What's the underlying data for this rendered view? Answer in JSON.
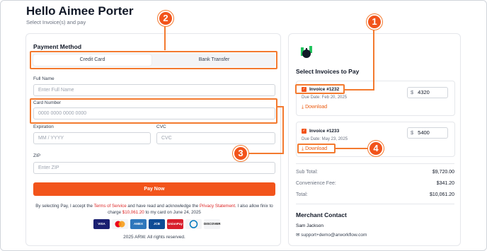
{
  "header": {
    "title": "Hello Aimee Porter",
    "subtitle": "Select Invoice(s) and pay"
  },
  "payment": {
    "section_title": "Payment Method",
    "tabs": [
      {
        "label": "Credit Card",
        "active": true
      },
      {
        "label": "Bank Transfer",
        "active": false
      }
    ],
    "full_name": {
      "label": "Full Name",
      "placeholder": "Enter Full Name"
    },
    "card_number": {
      "label": "Card Number",
      "placeholder": "0000 0000 0000 0000"
    },
    "expiration": {
      "label": "Expiration",
      "placeholder": "MM / YYYY"
    },
    "cvc": {
      "label": "CVC",
      "placeholder": "CVC"
    },
    "zip": {
      "label": "ZIP",
      "placeholder": "Enter ZIP"
    },
    "pay_button": "Pay Now",
    "terms": {
      "prefix": "By selecting Pay, I accept the ",
      "tos": "Terms of Service",
      "middle": " and have read and acknowledge the ",
      "privacy": "Privacy Statement",
      "suffix": ". I also allow finix to charge ",
      "amount": "$10,061.20",
      "end": " to my card on June 24, 2025"
    },
    "card_brands": [
      "VISA",
      "mastercard",
      "AMEX",
      "JCB",
      "UnionPay",
      "Diners",
      "DISCOVER"
    ],
    "copyright": "2025 ARW. All rights reserved."
  },
  "invoices": {
    "section_title": "Select Invoices to Pay",
    "items": [
      {
        "name": "Invoice #1232",
        "due": "Due Date: Feb 20, 2025",
        "download": "Download",
        "currency": "$",
        "amount": "4320"
      },
      {
        "name": "Invoice #1233",
        "due": "Due Date: May 23, 2025",
        "download": "Download",
        "currency": "$",
        "amount": "5400"
      }
    ]
  },
  "summary": {
    "subtotal_label": "Sub Total:",
    "subtotal": "$9,720.00",
    "fee_label": "Convenience Fee:",
    "fee": "$341.20",
    "total_label": "Total:",
    "total": "$10,061.20"
  },
  "merchant": {
    "title": "Merchant Contact",
    "name": "Sam Jackson",
    "email": "support+demo@arworkflow.com"
  },
  "callouts": [
    "1",
    "2",
    "3",
    "4"
  ],
  "colors": {
    "accent": "#f2541b",
    "highlight": "#f37a2f",
    "logo": "#22c55e"
  }
}
